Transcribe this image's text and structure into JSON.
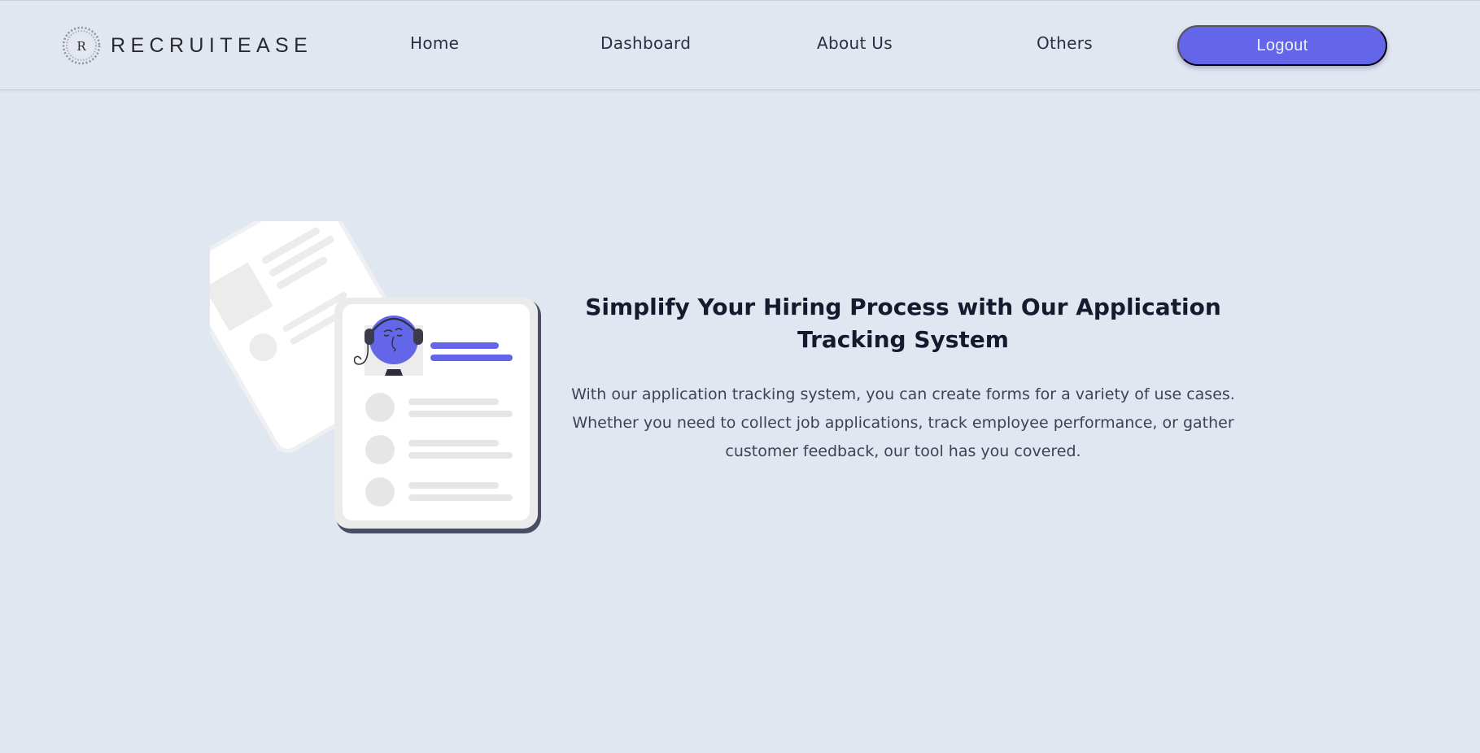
{
  "brand": {
    "logo_letter": "R",
    "name": "RECRUITEASE"
  },
  "nav": {
    "home": "Home",
    "dashboard": "Dashboard",
    "about": "About Us",
    "others": "Others",
    "logout": "Logout"
  },
  "hero": {
    "title": "Simplify Your Hiring Process with Our Application Tracking System",
    "description": "With our application tracking system, you can create forms for a variety of use cases. Whether you need to collect job applications, track employee performance, or gather customer feedback, our tool has you covered.",
    "illustration": "resume-cards-illustration"
  },
  "colors": {
    "background": "#e1e7f0",
    "accent": "#6366e8",
    "title": "#151a2e",
    "text": "#3d4356"
  }
}
